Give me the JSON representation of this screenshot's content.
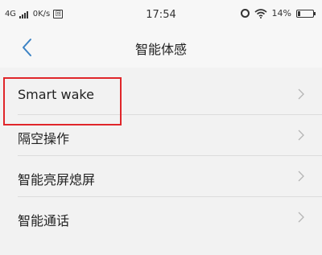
{
  "status_bar": {
    "network": "4G",
    "speed": "0K/s",
    "sim_badge": "回",
    "time": "17:54",
    "battery_percent": "14%",
    "battery_level": 0.14
  },
  "header": {
    "title": "智能体感",
    "back_icon": "chevron-left-icon"
  },
  "list": {
    "items": [
      {
        "label": "Smart wake"
      },
      {
        "label": "隔空操作"
      },
      {
        "label": "智能亮屏熄屏"
      },
      {
        "label": "智能通话"
      }
    ]
  },
  "colors": {
    "accent": "#3b82c4",
    "highlight": "#e0262a"
  }
}
